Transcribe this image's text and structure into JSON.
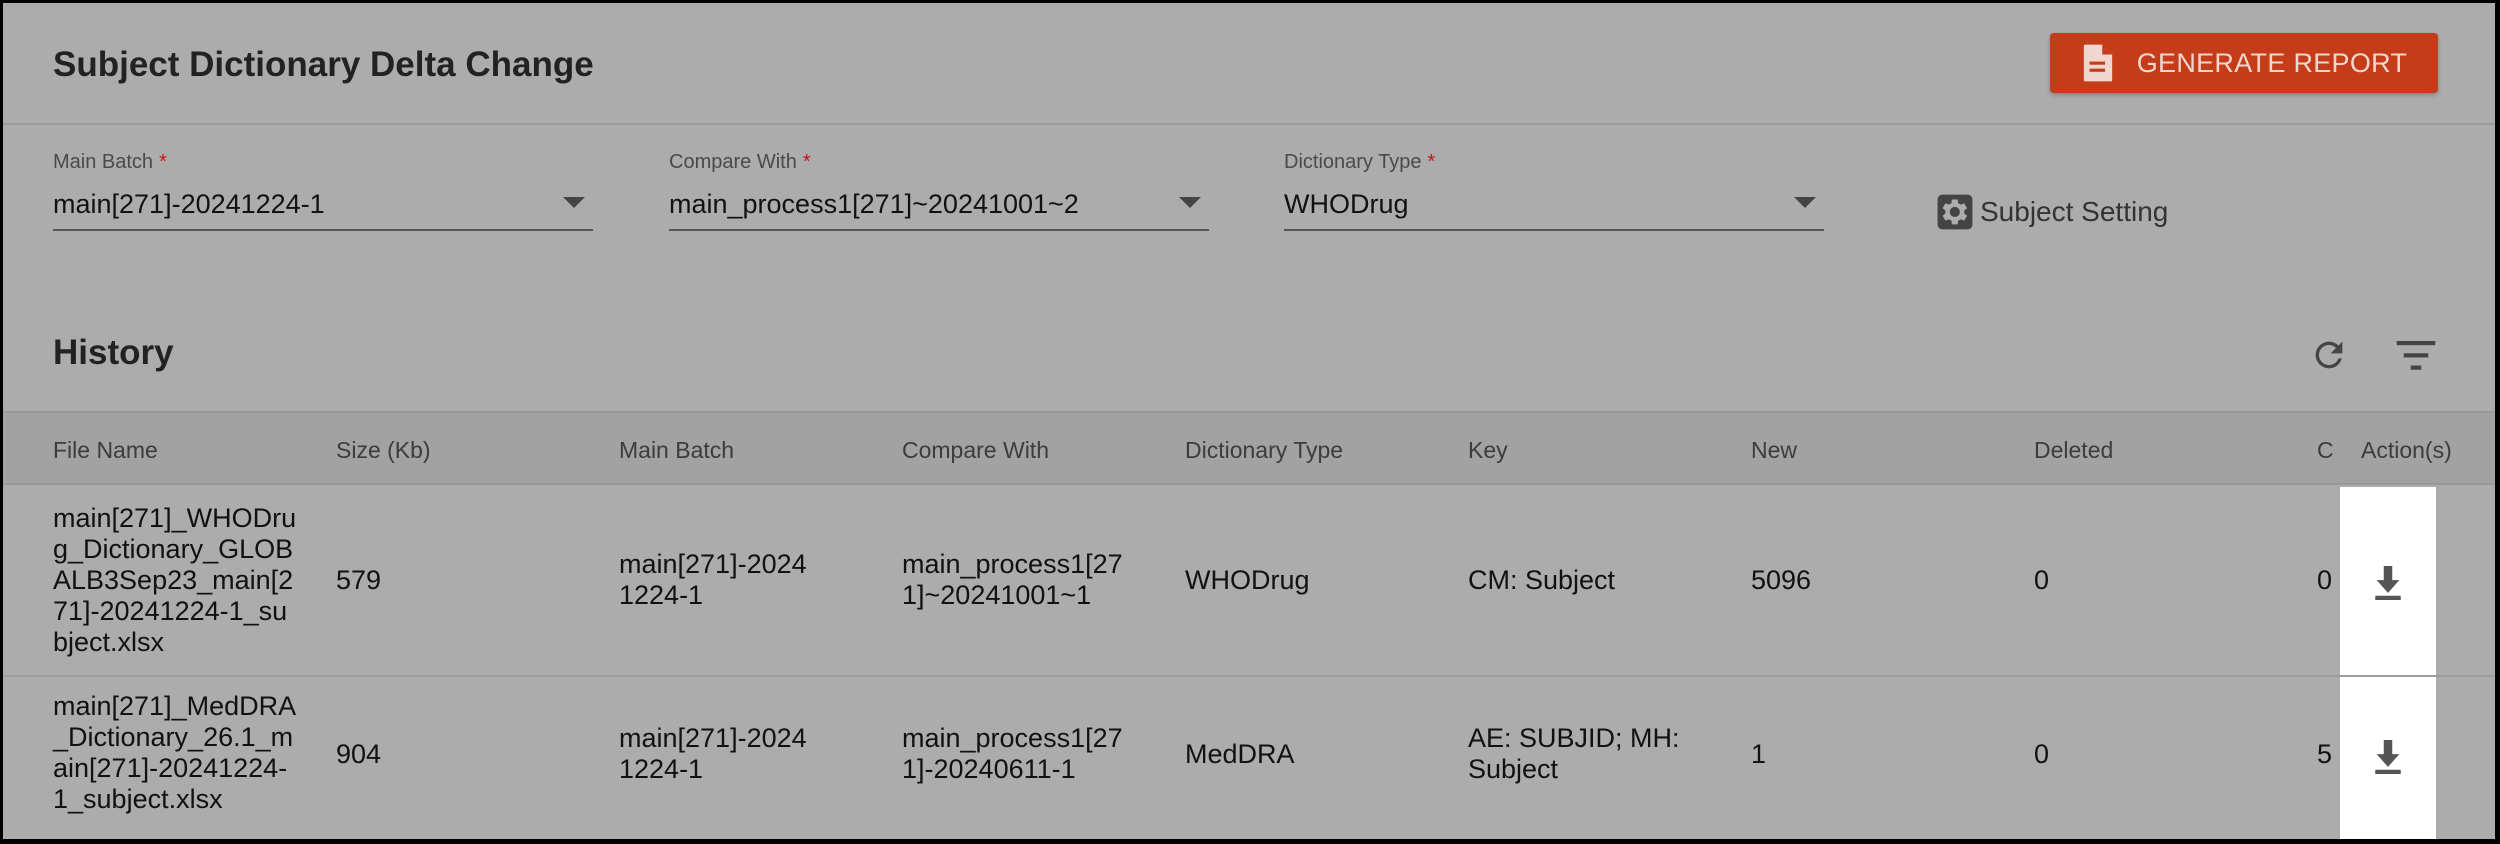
{
  "header": {
    "title": "Subject Dictionary Delta Change",
    "generate_label": "GENERATE REPORT",
    "generate_color": "#c43c18"
  },
  "form": {
    "main_batch": {
      "label": "Main Batch",
      "required": "*",
      "value": "main[271]-20241224-1"
    },
    "compare_with": {
      "label": "Compare With",
      "required": "*",
      "value": "main_process1[271]~20241001~2"
    },
    "dictionary_type": {
      "label": "Dictionary Type",
      "required": "*",
      "value": "WHODrug"
    },
    "subject_setting_label": "Subject Setting"
  },
  "history": {
    "title": "History",
    "columns": {
      "file_name": "File Name",
      "size": "Size (Kb)",
      "main_batch": "Main Batch",
      "compare_with": "Compare With",
      "dictionary_type": "Dictionary Type",
      "key": "Key",
      "new": "New",
      "deleted": "Deleted",
      "changed": "Cl",
      "actions": "Action(s)"
    },
    "rows": [
      {
        "file_name": "main[271]_WHODrug_Dictionary_GLOBALB3Sep23_main[271]-20241224-1_subject.xlsx",
        "size": "579",
        "main_batch": "main[271]-20241224-1",
        "compare_with": "main_process1[271]~20241001~1",
        "dictionary_type": "WHODrug",
        "key": "CM: Subject",
        "new": "5096",
        "deleted": "0",
        "changed": "0"
      },
      {
        "file_name": "main[271]_MedDRA_Dictionary_26.1_main[271]-20241224-1_subject.xlsx",
        "size": "904",
        "main_batch": "main[271]-20241224-1",
        "compare_with": "main_process1[271]-20240611-1",
        "dictionary_type": "MedDRA",
        "key": "AE: SUBJID; MH: Subject",
        "new": "1",
        "deleted": "0",
        "changed": "5"
      }
    ]
  }
}
